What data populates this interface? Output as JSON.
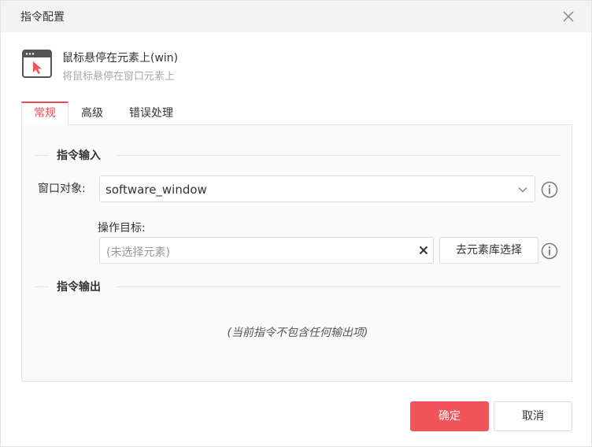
{
  "dialog": {
    "title": "指令配置",
    "close_icon": "close-icon"
  },
  "command": {
    "name": "鼠标悬停在元素上(win)",
    "description": "将鼠标悬停在窗口元素上",
    "icon": "window-cursor-icon",
    "icon_accent": "#f2545b"
  },
  "tabs": [
    {
      "label": "常规",
      "active": true
    },
    {
      "label": "高级",
      "active": false
    },
    {
      "label": "错误处理",
      "active": false
    }
  ],
  "input_section": {
    "title": "指令输入",
    "window_label": "窗口对象:",
    "window_value": "software_window",
    "target_label": "操作目标:",
    "target_placeholder": "(未选择元素)",
    "library_button": "去元素库选择"
  },
  "output_section": {
    "title": "指令输出",
    "empty_text": "(当前指令不包含任何输出项)"
  },
  "footer": {
    "ok_label": "确定",
    "cancel_label": "取消"
  },
  "colors": {
    "accent": "#f2545b",
    "titlebar_bg": "#f3f3f3",
    "panel_bg": "#fafafa"
  }
}
